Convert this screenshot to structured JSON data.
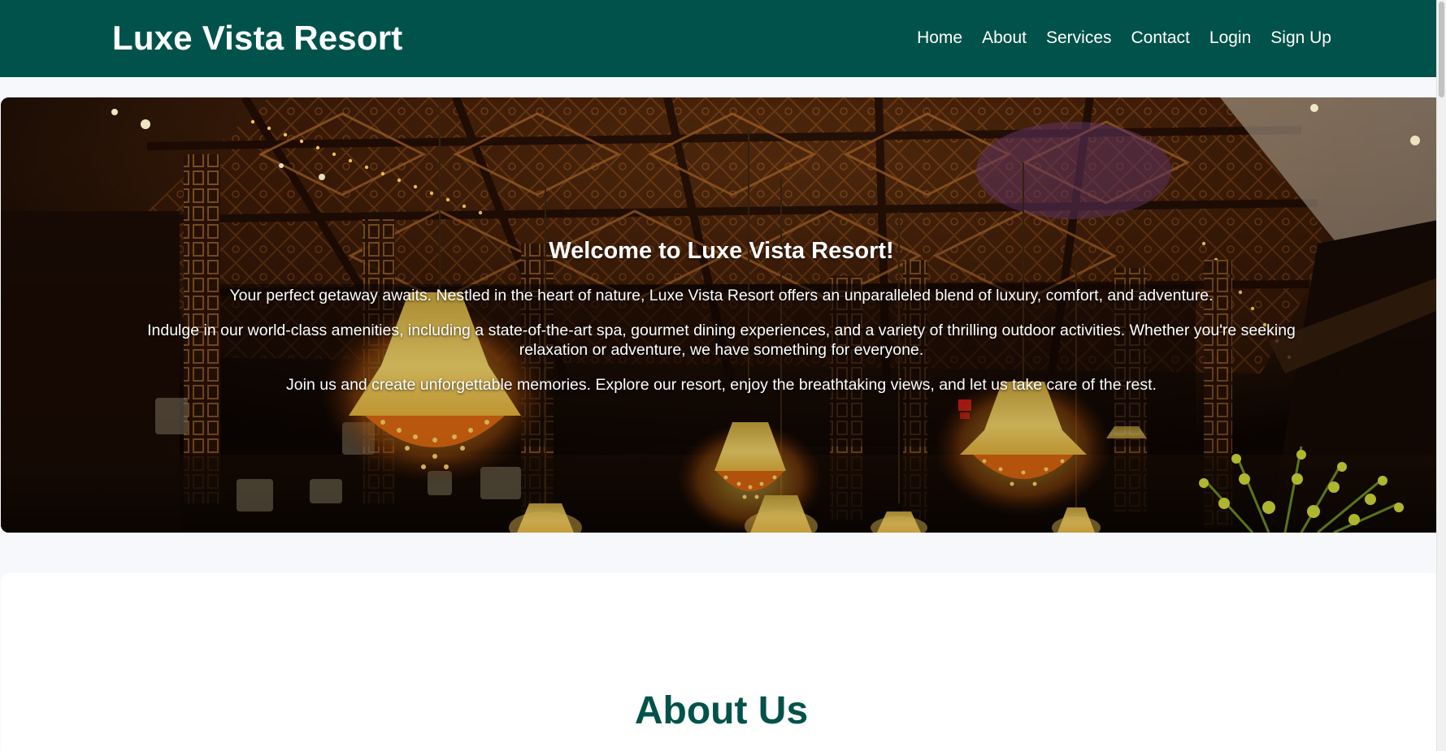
{
  "header": {
    "brand": "Luxe Vista Resort",
    "nav": [
      "Home",
      "About",
      "Services",
      "Contact",
      "Login",
      "Sign Up"
    ]
  },
  "hero": {
    "title": "Welcome to Luxe Vista Resort!",
    "paragraphs": [
      "Your perfect getaway awaits. Nestled in the heart of nature, Luxe Vista Resort offers an unparalleled blend of luxury, comfort, and adventure.",
      "Indulge in our world-class amenities, including a state-of-the-art spa, gourmet dining experiences, and a variety of thrilling outdoor activities. Whether you're seeking relaxation or adventure, we have something for everyone.",
      "Join us and create unforgettable memories. Explore our resort, enjoy the breathtaking views, and let us take care of the rest."
    ]
  },
  "about": {
    "title": "About Us"
  },
  "colors": {
    "brand_green": "#00524a",
    "page_background": "#f6f8fb",
    "text_light": "#ffffff"
  }
}
